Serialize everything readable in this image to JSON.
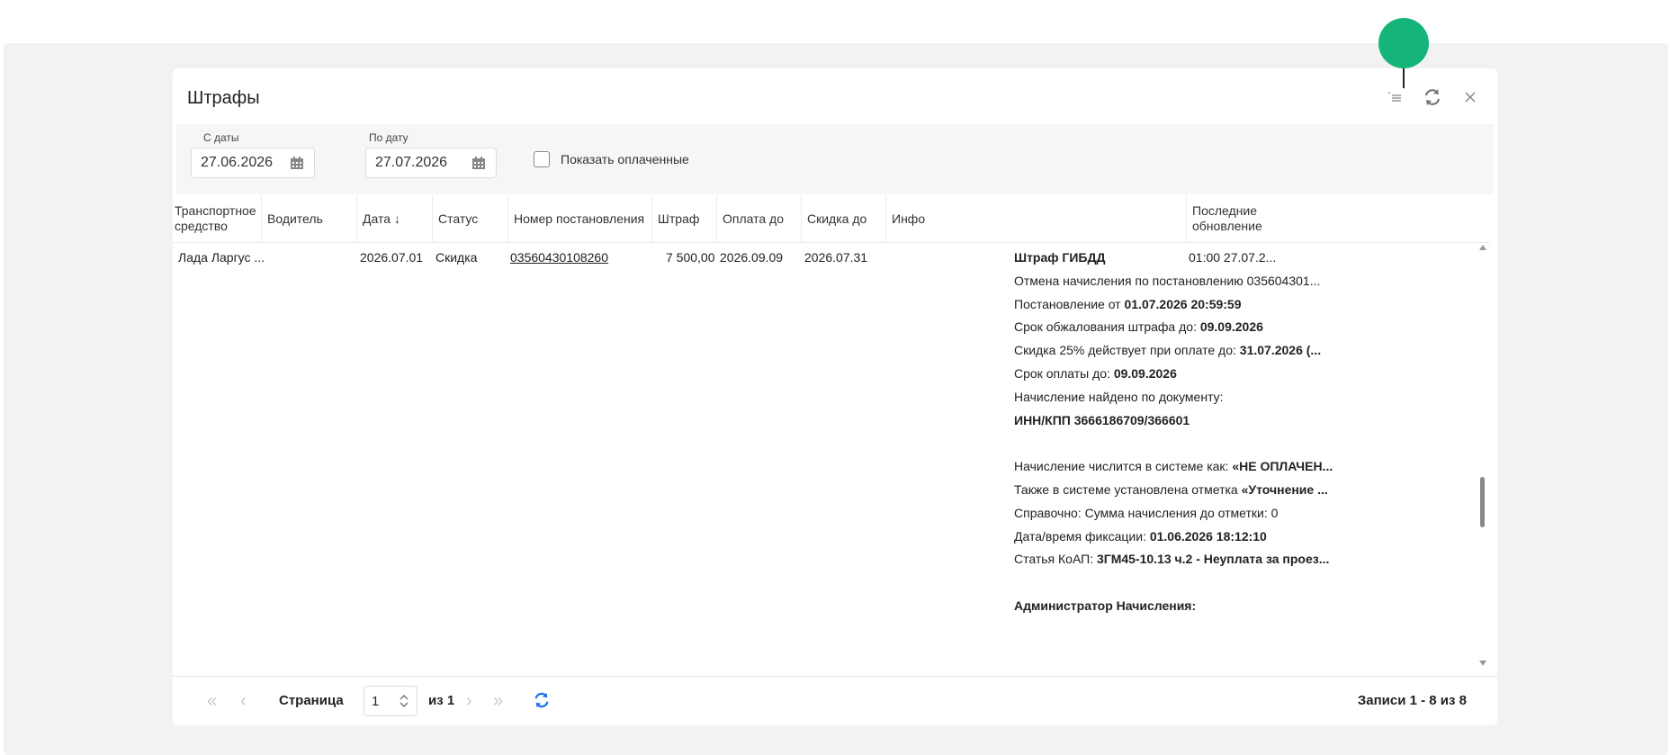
{
  "panel": {
    "title": "Штрафы"
  },
  "filters": {
    "from_label": "С даты",
    "from_value": "27.06.2026",
    "to_label": "По дату",
    "to_value": "27.07.2026",
    "show_paid_label": "Показать оплаченные",
    "show_paid_checked": false
  },
  "table": {
    "columns": [
      "Транспортное средство",
      "Водитель",
      "Дата ↓",
      "Статус",
      "Номер постановления",
      "Штраф",
      "Оплата до",
      "Скидка до",
      "Инфо",
      "Последние обновление"
    ],
    "row": {
      "vehicle": "Лада Ларгус ...",
      "driver": "",
      "date": "2026.07.01",
      "status": "Скидка",
      "number": "03560430108260",
      "fine": "7 500,00",
      "pay_until": "2026.09.09",
      "discount_until": "2026.07.31",
      "updated": "01:00 27.07.2..."
    },
    "info_lines": [
      {
        "plain": "",
        "bold": "Штраф ГИБДД"
      },
      {
        "plain": "Отмена начисления по постановлению 035604301...",
        "bold": ""
      },
      {
        "plain": "Постановление от ",
        "bold": "01.07.2026 20:59:59"
      },
      {
        "plain": "Срок обжалования штрафа до: ",
        "bold": "09.09.2026"
      },
      {
        "plain": "Скидка 25% действует при оплате до: ",
        "bold": "31.07.2026 (..."
      },
      {
        "plain": "Срок оплаты до: ",
        "bold": "09.09.2026"
      },
      {
        "plain": "Начисление найдено по документу:",
        "bold": ""
      },
      {
        "plain": "",
        "bold": "ИНН/КПП 3666186709/366601"
      },
      {
        "plain": "",
        "bold": ""
      },
      {
        "plain": "Начисление числится в системе как: ",
        "bold": "«НЕ ОПЛАЧЕН..."
      },
      {
        "plain": "Также в системе установлена отметка ",
        "bold": "«Уточнение ..."
      },
      {
        "plain": "Справочно: Сумма начисления до отметки: 0",
        "bold": ""
      },
      {
        "plain": "Дата/время фиксации: ",
        "bold": "01.06.2026 18:12:10"
      },
      {
        "plain": "Статья КоАП: ",
        "bold": "3ГМ45-10.13 ч.2 - Неуплата за проез..."
      },
      {
        "plain": "",
        "bold": ""
      },
      {
        "plain": "",
        "bold": "Администратор Начисления:"
      }
    ]
  },
  "pager": {
    "page_label": "Страница",
    "page_value": "1",
    "of_label": "из 1",
    "records": "Записи 1 - 8 из 8"
  },
  "colors": {
    "accent": "#15b57a",
    "refresh": "#1a73e8"
  },
  "icons": [
    "columns-icon",
    "refresh-icon",
    "close-icon",
    "calendar-icon",
    "first-page-icon",
    "prev-page-icon",
    "next-page-icon",
    "last-page-icon",
    "stepper-icon"
  ]
}
